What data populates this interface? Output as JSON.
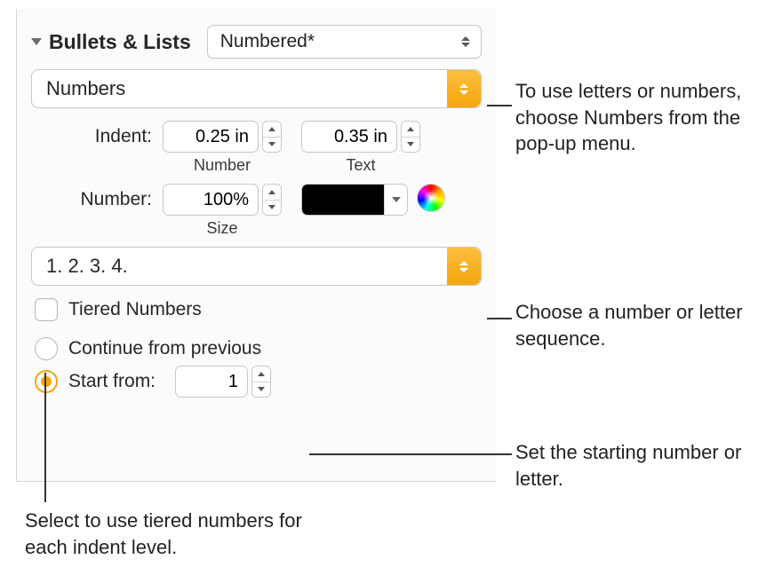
{
  "header": {
    "section_title": "Bullets & Lists",
    "style_popup": "Numbered*"
  },
  "type_popup": "Numbers",
  "indent": {
    "label": "Indent:",
    "number_value": "0.25 in",
    "number_sublabel": "Number",
    "text_value": "0.35 in",
    "text_sublabel": "Text"
  },
  "number": {
    "label": "Number:",
    "size_value": "100%",
    "size_sublabel": "Size"
  },
  "sequence_popup": "1. 2. 3. 4.",
  "tiered_label": "Tiered Numbers",
  "continue_label": "Continue from previous",
  "start_from_label": "Start from:",
  "start_from_value": "1",
  "callouts": {
    "c1": "To use letters or numbers, choose Numbers from the pop-up menu.",
    "c2": "Choose a number or letter sequence.",
    "c3": "Set the starting number or letter.",
    "c4": "Select to use tiered numbers for each indent level."
  }
}
